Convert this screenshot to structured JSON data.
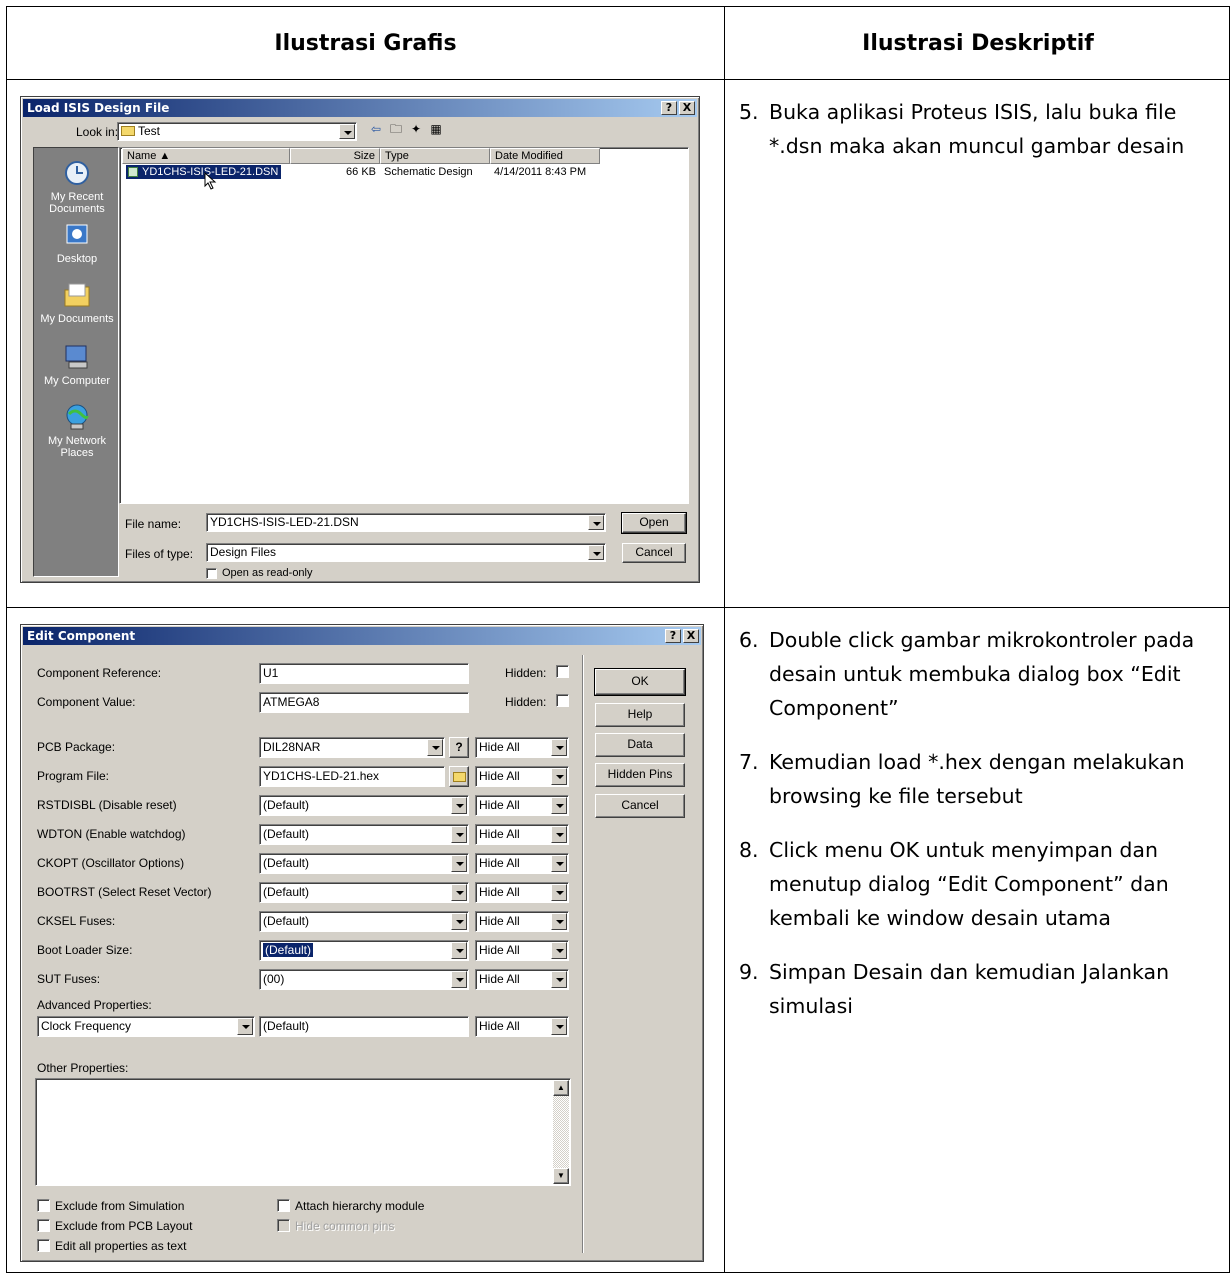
{
  "headers": {
    "left": "Ilustrasi Grafis",
    "right": "Ilustrasi Deskriptif"
  },
  "row1_desc": [
    {
      "num": "5.",
      "text": "Buka aplikasi Proteus ISIS, lalu buka file *.dsn maka akan muncul gambar desain"
    }
  ],
  "row2_desc": [
    {
      "num": "6.",
      "text": "Double click gambar mikrokontroler pada desain untuk membuka dialog box “Edit Component”"
    },
    {
      "num": "7.",
      "text": "Kemudian load *.hex dengan melakukan browsing ke file tersebut"
    },
    {
      "num": "8.",
      "text": "Click menu OK untuk menyimpan dan menutup dialog “Edit Component” dan kembali ke window desain utama"
    },
    {
      "num": "9.",
      "text": "Simpan Desain dan kemudian Jalankan simulasi"
    }
  ],
  "load_dialog": {
    "title": "Load ISIS Design File",
    "help_btn": "?",
    "close_btn": "X",
    "look_in_label": "Look in:",
    "look_in_value": "Test",
    "sidebar": [
      {
        "label": "My Recent Documents",
        "icon": "recent-documents-icon"
      },
      {
        "label": "Desktop",
        "icon": "desktop-icon"
      },
      {
        "label": "My Documents",
        "icon": "my-documents-icon"
      },
      {
        "label": "My Computer",
        "icon": "my-computer-icon"
      },
      {
        "label": "My Network Places",
        "icon": "network-places-icon"
      }
    ],
    "columns": [
      "Name",
      "Size",
      "Type",
      "Date Modified"
    ],
    "files": [
      {
        "name": "YD1CHS-ISIS-LED-21.DSN",
        "size": "66 KB",
        "type": "Schematic Design",
        "date": "4/14/2011 8:43 PM"
      }
    ],
    "file_name_label": "File name:",
    "file_name_value": "YD1CHS-ISIS-LED-21.DSN",
    "files_of_type_label": "Files of type:",
    "files_of_type_value": "Design Files",
    "read_only_label": "Open as read-only",
    "open_btn": "Open",
    "cancel_btn": "Cancel"
  },
  "edit_dialog": {
    "title": "Edit Component",
    "help_btn": "?",
    "close_btn": "X",
    "comp_ref_label": "Component Reference:",
    "comp_ref_value": "U1",
    "comp_val_label": "Component Value:",
    "comp_val_value": "ATMEGA8",
    "hidden_label": "Hidden:",
    "properties": [
      {
        "label": "PCB Package:",
        "value": "DIL28NAR",
        "vis": "Hide All"
      },
      {
        "label": "Program File:",
        "value": "YD1CHS-LED-21.hex",
        "vis": "Hide All"
      },
      {
        "label": "RSTDISBL (Disable reset)",
        "value": "(Default)",
        "vis": "Hide All"
      },
      {
        "label": "WDTON (Enable watchdog)",
        "value": "(Default)",
        "vis": "Hide All"
      },
      {
        "label": "CKOPT (Oscillator Options)",
        "value": "(Default)",
        "vis": "Hide All"
      },
      {
        "label": "BOOTRST (Select Reset Vector)",
        "value": "(Default)",
        "vis": "Hide All"
      },
      {
        "label": "CKSEL Fuses:",
        "value": "(Default)",
        "vis": "Hide All"
      },
      {
        "label": "Boot Loader Size:",
        "value": "(Default)",
        "vis": "Hide All"
      },
      {
        "label": "SUT Fuses:",
        "value": "(00)",
        "vis": "Hide All"
      }
    ],
    "advanced_label": "Advanced Properties:",
    "advanced_select": "Clock Frequency",
    "advanced_value": "(Default)",
    "advanced_vis": "Hide All",
    "other_label": "Other Properties:",
    "checks": [
      "Exclude from Simulation",
      "Exclude from PCB Layout",
      "Edit all properties as text",
      "Attach hierarchy module",
      "Hide common pins"
    ],
    "buttons": [
      "OK",
      "Help",
      "Data",
      "Hidden Pins",
      "Cancel"
    ]
  }
}
